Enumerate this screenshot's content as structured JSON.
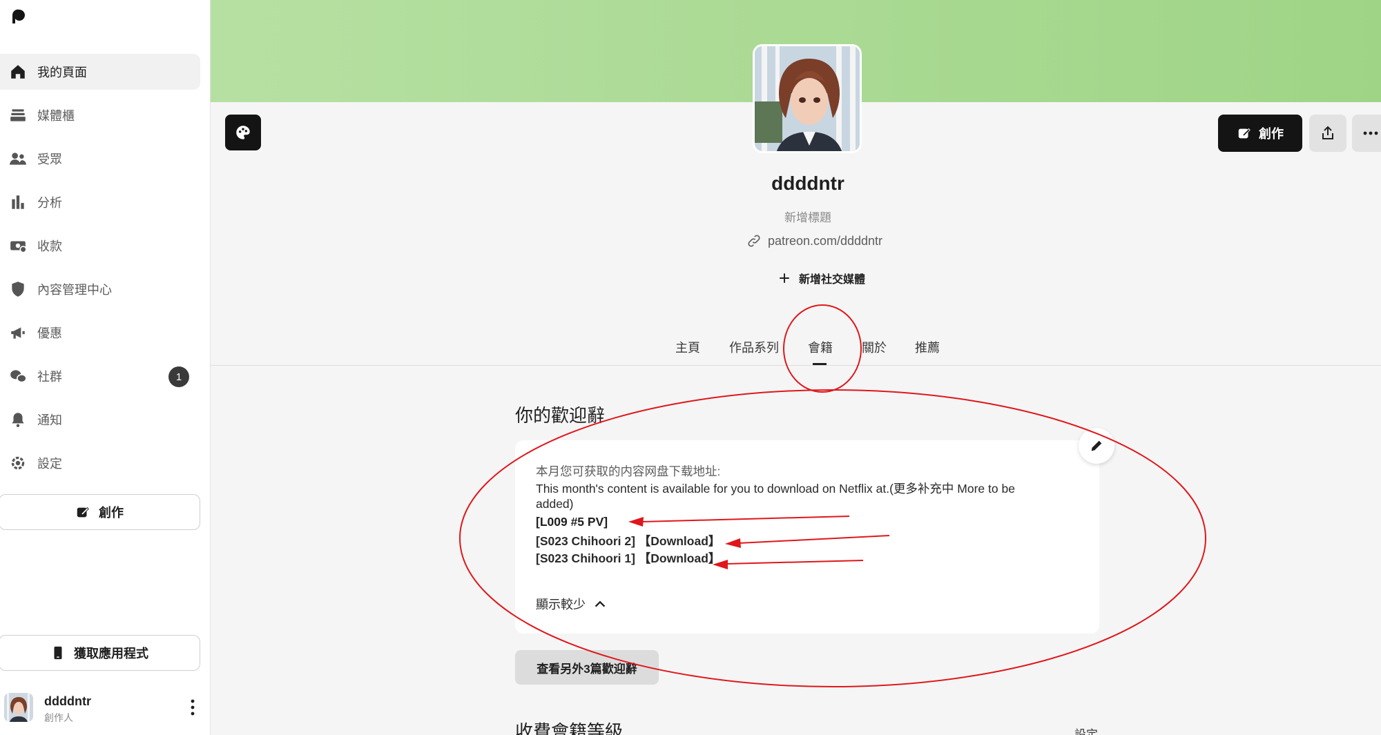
{
  "sidebar": {
    "items": [
      {
        "label": "我的頁面",
        "icon": "home-icon"
      },
      {
        "label": "媒體櫃",
        "icon": "library-icon"
      },
      {
        "label": "受眾",
        "icon": "audience-icon"
      },
      {
        "label": "分析",
        "icon": "bar-chart-icon"
      },
      {
        "label": "收款",
        "icon": "payout-icon"
      },
      {
        "label": "內容管理中心",
        "icon": "shield-icon"
      },
      {
        "label": "優惠",
        "icon": "megaphone-icon"
      },
      {
        "label": "社群",
        "icon": "community-icon",
        "badge": "1"
      },
      {
        "label": "通知",
        "icon": "bell-icon"
      },
      {
        "label": "設定",
        "icon": "gear-icon"
      }
    ],
    "create_label": "創作",
    "get_app_label": "獲取應用程式",
    "user": {
      "name": "ddddntr",
      "role": "創作人"
    }
  },
  "header": {
    "create_label": "創作",
    "creator_name": "ddddntr",
    "headline": "新增標題",
    "url": "patreon.com/ddddntr",
    "add_social": "新增社交媒體"
  },
  "tabs": [
    {
      "label": "主頁"
    },
    {
      "label": "作品系列"
    },
    {
      "label": "會籍",
      "active": true
    },
    {
      "label": "關於"
    },
    {
      "label": "推薦"
    }
  ],
  "welcome": {
    "title": "你的歡迎辭",
    "line1": "本月您可获取的内容网盘下载地址:",
    "line2": "This month's content is available for you to download on Netflix at.(更多补充中 More to be",
    "line3": "added)",
    "item1": "[L009 #5 PV]",
    "item2_a": "[S023 Chihoori 2]",
    "item2_b": "【Download】",
    "item3_a": "[S023 Chihoori 1]",
    "item3_b": "【Download】",
    "show_less": "顯示較少",
    "more_button": "查看另外3篇歡迎辭"
  },
  "tiers": {
    "title": "收費會籍等級",
    "settings": "設定"
  },
  "colors": {
    "banner": "#b6e0a2",
    "annotation": "#e0161a",
    "dark_button": "#141414"
  }
}
